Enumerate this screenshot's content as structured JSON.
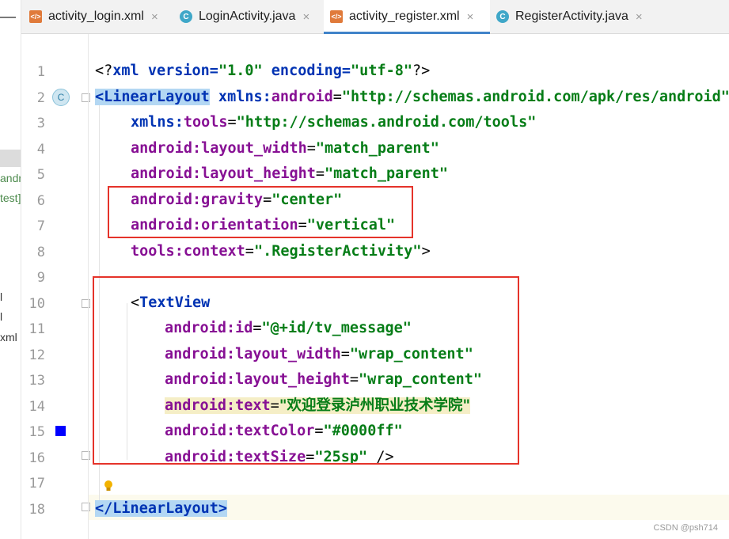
{
  "left_panel": {
    "fragments": [
      "andr",
      "test]",
      "l",
      "l",
      "xml"
    ]
  },
  "tabs": [
    {
      "name": "activity_login.xml",
      "type": "xml",
      "active": false
    },
    {
      "name": "LoginActivity.java",
      "type": "java",
      "active": false
    },
    {
      "name": "activity_register.xml",
      "type": "xml",
      "active": true
    },
    {
      "name": "RegisterActivity.java",
      "type": "java",
      "active": false
    }
  ],
  "icons": {
    "close": "×",
    "xml_file": "</>",
    "java_class": "C"
  },
  "gutter": {
    "line_numbers": [
      "1",
      "2",
      "3",
      "4",
      "5",
      "6",
      "7",
      "8",
      "9",
      "10",
      "11",
      "12",
      "13",
      "14",
      "15",
      "16",
      "17",
      "18"
    ],
    "line2_marker": "C",
    "line15_color_swatch": "#0000ff"
  },
  "code": {
    "l1": {
      "a": "<?",
      "b": "xml",
      "c": " version=",
      "d": "\"1.0\"",
      "e": " encoding=",
      "f": "\"utf-8\"",
      "g": "?>"
    },
    "l2": {
      "a": "<LinearLayout",
      "b": " xmlns:",
      "c": "android",
      "d": "=",
      "e": "\"http://schemas.android.com/apk/res/android\""
    },
    "l3": {
      "a": "xmlns:",
      "b": "tools",
      "c": "=",
      "d": "\"http://schemas.android.com/tools\""
    },
    "l4": {
      "a": "android:",
      "b": "layout_width",
      "c": "=",
      "d": "\"match_parent\""
    },
    "l5": {
      "a": "android:",
      "b": "layout_height",
      "c": "=",
      "d": "\"match_parent\""
    },
    "l6": {
      "a": "android:",
      "b": "gravity",
      "c": "=",
      "d": "\"center\""
    },
    "l7": {
      "a": "android:",
      "b": "orientation",
      "c": "=",
      "d": "\"vertical\""
    },
    "l8": {
      "a": "tools:",
      "b": "context",
      "c": "=",
      "d": "\".RegisterActivity\"",
      "e": ">"
    },
    "l10": {
      "a": "<",
      "b": "TextView"
    },
    "l11": {
      "a": "android:",
      "b": "id",
      "c": "=",
      "d": "\"@+id/tv_message\""
    },
    "l12": {
      "a": "android:",
      "b": "layout_width",
      "c": "=",
      "d": "\"wrap_content\""
    },
    "l13": {
      "a": "android:",
      "b": "layout_height",
      "c": "=",
      "d": "\"wrap_content\""
    },
    "l14": {
      "a": "android:",
      "b": "text",
      "c": "=",
      "d": "\"欢迎登录泸州职业技术学院\""
    },
    "l15": {
      "a": "android:",
      "b": "textColor",
      "c": "=",
      "d": "\"#0000ff\""
    },
    "l16": {
      "a": "android:",
      "b": "textSize",
      "c": "=",
      "d": "\"25sp\"",
      "e": " />"
    },
    "l18": {
      "a": "</LinearLayout>"
    }
  },
  "watermark": "CSDN @psh714",
  "colors": {
    "string": "#067d17",
    "namespace": "#871094",
    "tag": "#0033b3",
    "annotation_box": "#e5332a",
    "active_tab_underline": "#4083c9"
  }
}
